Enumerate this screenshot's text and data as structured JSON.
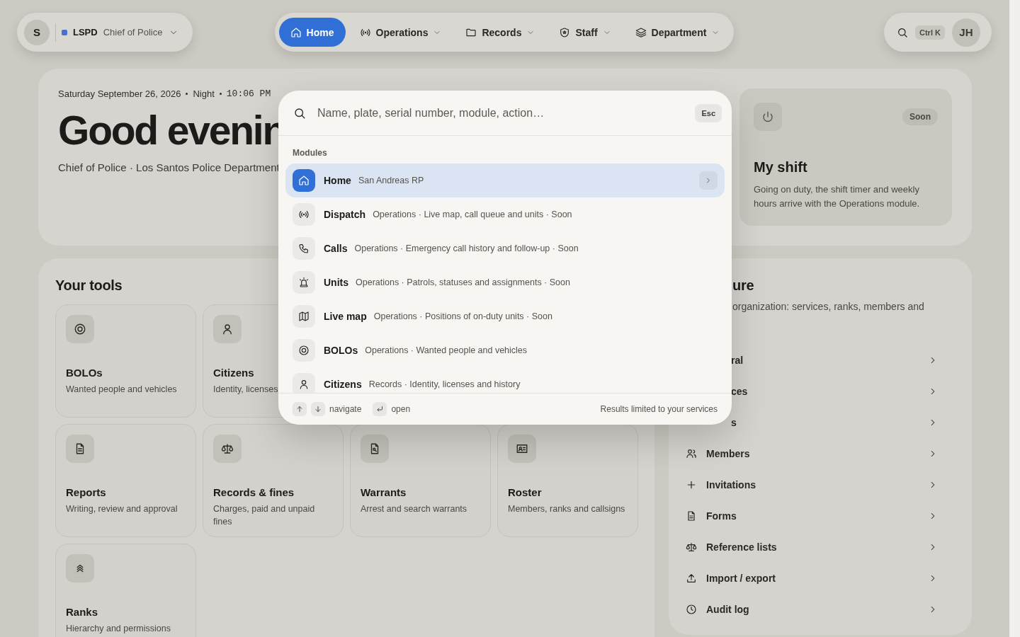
{
  "org": {
    "avatar": "S",
    "code": "LSPD",
    "role": "Chief of Police"
  },
  "nav": [
    {
      "label": "Home",
      "selected": true,
      "menu": false
    },
    {
      "label": "Operations",
      "selected": false,
      "menu": true
    },
    {
      "label": "Records",
      "selected": false,
      "menu": true
    },
    {
      "label": "Staff",
      "selected": false,
      "menu": true
    },
    {
      "label": "Department",
      "selected": false,
      "menu": true
    }
  ],
  "search": {
    "shortcut": "Ctrl K"
  },
  "user": {
    "initials": "JH"
  },
  "hero": {
    "date": "Saturday September 26, 2026",
    "period": "Night",
    "time": "10:06 PM",
    "greeting": "Good evenin",
    "subtitle": "Chief of Police · Los Santos Police Department"
  },
  "shift": {
    "badge": "Soon",
    "title": "My shift",
    "text": "Going on duty, the shift timer and weekly hours arrive with the Operations module."
  },
  "tools": {
    "title": "Your tools",
    "rows": [
      [
        {
          "title": "BOLOs",
          "text": "Wanted people and vehicles"
        },
        {
          "title": "Citizens",
          "text": "Identity, licenses"
        }
      ],
      [
        {
          "title": "Reports",
          "text": "Writing, review and approval"
        },
        {
          "title": "Records & fines",
          "text": "Charges, paid and unpaid fines"
        },
        {
          "title": "Warrants",
          "text": "Arrest and search warrants"
        },
        {
          "title": "Roster",
          "text": "Members, ranks and callsigns"
        }
      ],
      [
        {
          "title": "Ranks",
          "text": "Hierarchy and permissions"
        }
      ]
    ]
  },
  "configure": {
    "title": "ure",
    "description": "organization: services, ranks, members and",
    "items": [
      {
        "label": "ral",
        "kind": "covered"
      },
      {
        "label": "ces",
        "kind": "covered"
      },
      {
        "label": "s",
        "kind": "covered"
      },
      {
        "label": "Members",
        "kind": "link"
      },
      {
        "label": "Invitations",
        "kind": "link"
      },
      {
        "label": "Forms",
        "kind": "link"
      },
      {
        "label": "Reference lists",
        "kind": "link"
      },
      {
        "label": "Import / export",
        "kind": "link"
      },
      {
        "label": "Audit log",
        "kind": "link"
      }
    ]
  },
  "palette": {
    "placeholder": "Name, plate, serial number, module, action…",
    "esc": "Esc",
    "section": "Modules",
    "results": [
      {
        "title": "Home",
        "detail": "San Andreas RP",
        "selected": true
      },
      {
        "title": "Dispatch",
        "detail": "Operations · Live map, call queue and units · Soon",
        "selected": false
      },
      {
        "title": "Calls",
        "detail": "Operations · Emergency call history and follow-up · Soon",
        "selected": false
      },
      {
        "title": "Units",
        "detail": "Operations · Patrols, statuses and assignments · Soon",
        "selected": false
      },
      {
        "title": "Live map",
        "detail": "Operations · Positions of on-duty units · Soon",
        "selected": false
      },
      {
        "title": "BOLOs",
        "detail": "Operations · Wanted people and vehicles",
        "selected": false
      },
      {
        "title": "Citizens",
        "detail": "Records · Identity, licenses and history",
        "selected": false
      }
    ],
    "navigate": "navigate",
    "open": "open",
    "note": "Results limited to your services"
  }
}
